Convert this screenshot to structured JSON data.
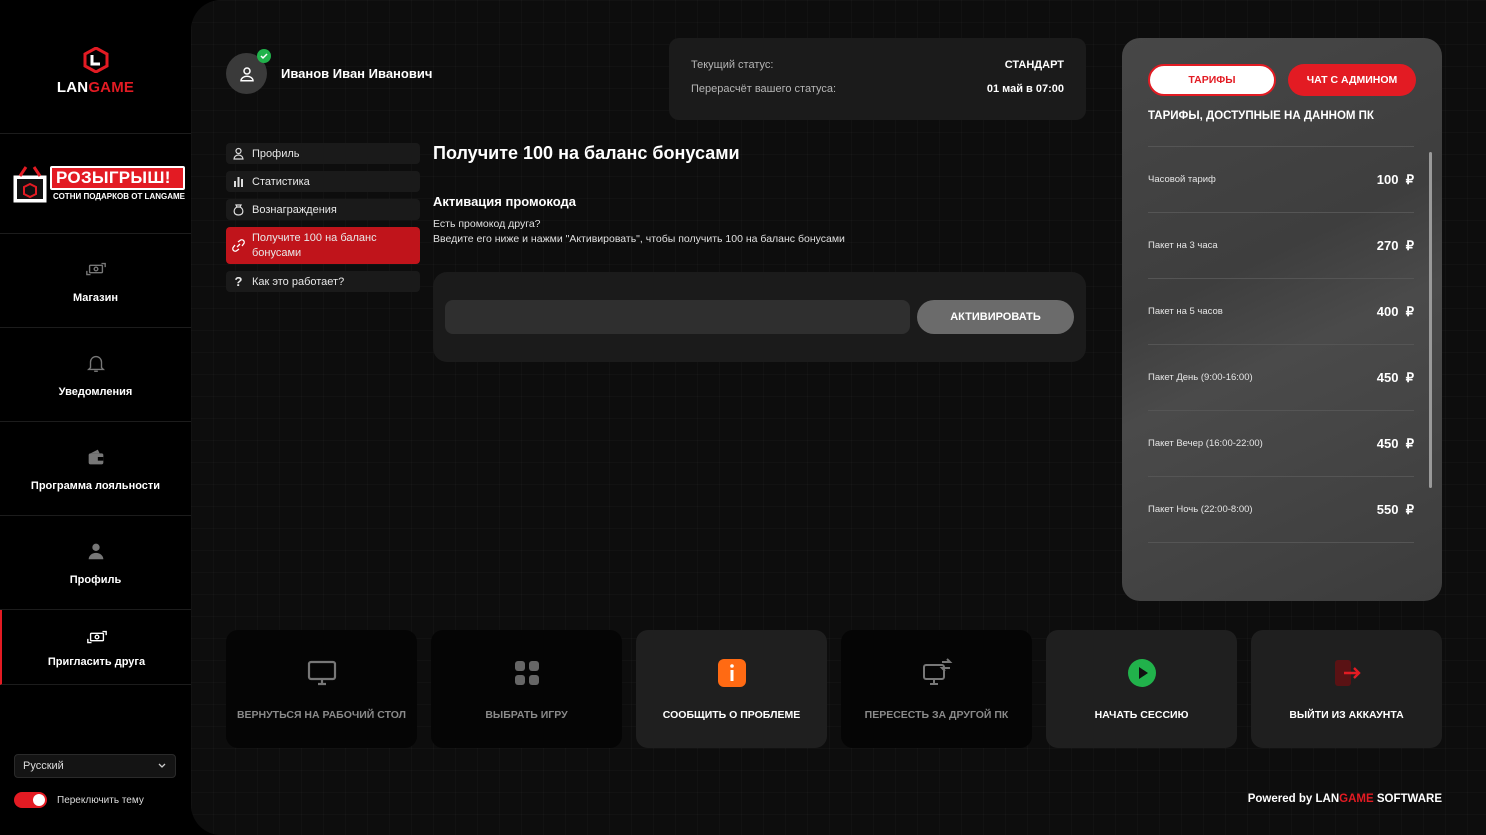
{
  "brand": {
    "logo_prefix": "LAN",
    "logo_suffix": "GAME",
    "accent_color": "#e31b23"
  },
  "promo_banner": {
    "title": "РОЗЫГРЫШ!",
    "subtitle": "СОТНИ ПОДАРКОВ ОТ LANGAME"
  },
  "sidebar": {
    "items": [
      {
        "label": "Магазин",
        "icon": "cash-exchange-icon"
      },
      {
        "label": "Уведомления",
        "icon": "bell-icon"
      },
      {
        "label": "Программа лояльности",
        "icon": "wallet-icon"
      },
      {
        "label": "Профиль",
        "icon": "user-icon"
      },
      {
        "label": "Пригласить друга",
        "icon": "cash-exchange-icon"
      }
    ],
    "language": "Русский",
    "theme_toggle_label": "Переключить тему"
  },
  "user": {
    "name": "Иванов Иван Иванович"
  },
  "status": {
    "current_label": "Текущий статус:",
    "current_value": "СТАНДАРТ",
    "recalc_label": "Перерасчёт вашего статуса:",
    "recalc_value": "01 май в 07:00"
  },
  "profile_menu": {
    "items": [
      {
        "label": "Профиль",
        "icon": "user-icon"
      },
      {
        "label": "Статистика",
        "icon": "bar-chart-icon"
      },
      {
        "label": "Вознаграждения",
        "icon": "reward-bag-icon"
      },
      {
        "label": "Получите 100 на баланс бонусами",
        "icon": "link-icon"
      },
      {
        "label": "Как это работает?",
        "icon": "question-icon"
      }
    ]
  },
  "content": {
    "title": "Получите 100 на баланс бонусами",
    "section_title": "Активация промокода",
    "line1": "Есть промокод друга?",
    "line2": "Введите его ниже и нажми \"Активировать\", чтобы получить 100 на баланс бонусами",
    "input_value": "",
    "activate_label": "АКТИВИРОВАТЬ"
  },
  "tariffs": {
    "tab_tariffs": "ТАРИФЫ",
    "tab_chat": "ЧАТ С АДМИНОМ",
    "heading": "ТАРИФЫ, ДОСТУПНЫЕ НА ДАННОМ ПК",
    "currency": "₽",
    "rows": [
      {
        "name": "Часовой тариф",
        "price": "100"
      },
      {
        "name": "Пакет на 3 часа",
        "price": "270"
      },
      {
        "name": "Пакет на 5 часов",
        "price": "400"
      },
      {
        "name": "Пакет День (9:00-16:00)",
        "price": "450"
      },
      {
        "name": "Пакет Вечер (16:00-22:00)",
        "price": "450"
      },
      {
        "name": "Пакет Ночь (22:00-8:00)",
        "price": "550"
      }
    ]
  },
  "actions": [
    {
      "label": "ВЕРНУТЬСЯ НА РАБОЧИЙ СТОЛ",
      "icon": "monitor-icon"
    },
    {
      "label": "ВЫБРАТЬ ИГРУ",
      "icon": "grid-icon"
    },
    {
      "label": "СООБЩИТЬ О ПРОБЛЕМЕ",
      "icon": "info-icon",
      "color": "#ff6a13"
    },
    {
      "label": "ПЕРЕСЕСТЬ ЗА ДРУГОЙ ПК",
      "icon": "monitor-switch-icon"
    },
    {
      "label": "НАЧАТЬ СЕССИЮ",
      "icon": "play-icon",
      "color": "#21b24b"
    },
    {
      "label": "ВЫЙТИ ИЗ АККАУНТА",
      "icon": "logout-icon",
      "color": "#e31b23"
    }
  ],
  "footer": {
    "powered_by": "Powered by",
    "brand_prefix": "LAN",
    "brand_suffix": "GAME",
    "software": "SOFTWARE"
  }
}
